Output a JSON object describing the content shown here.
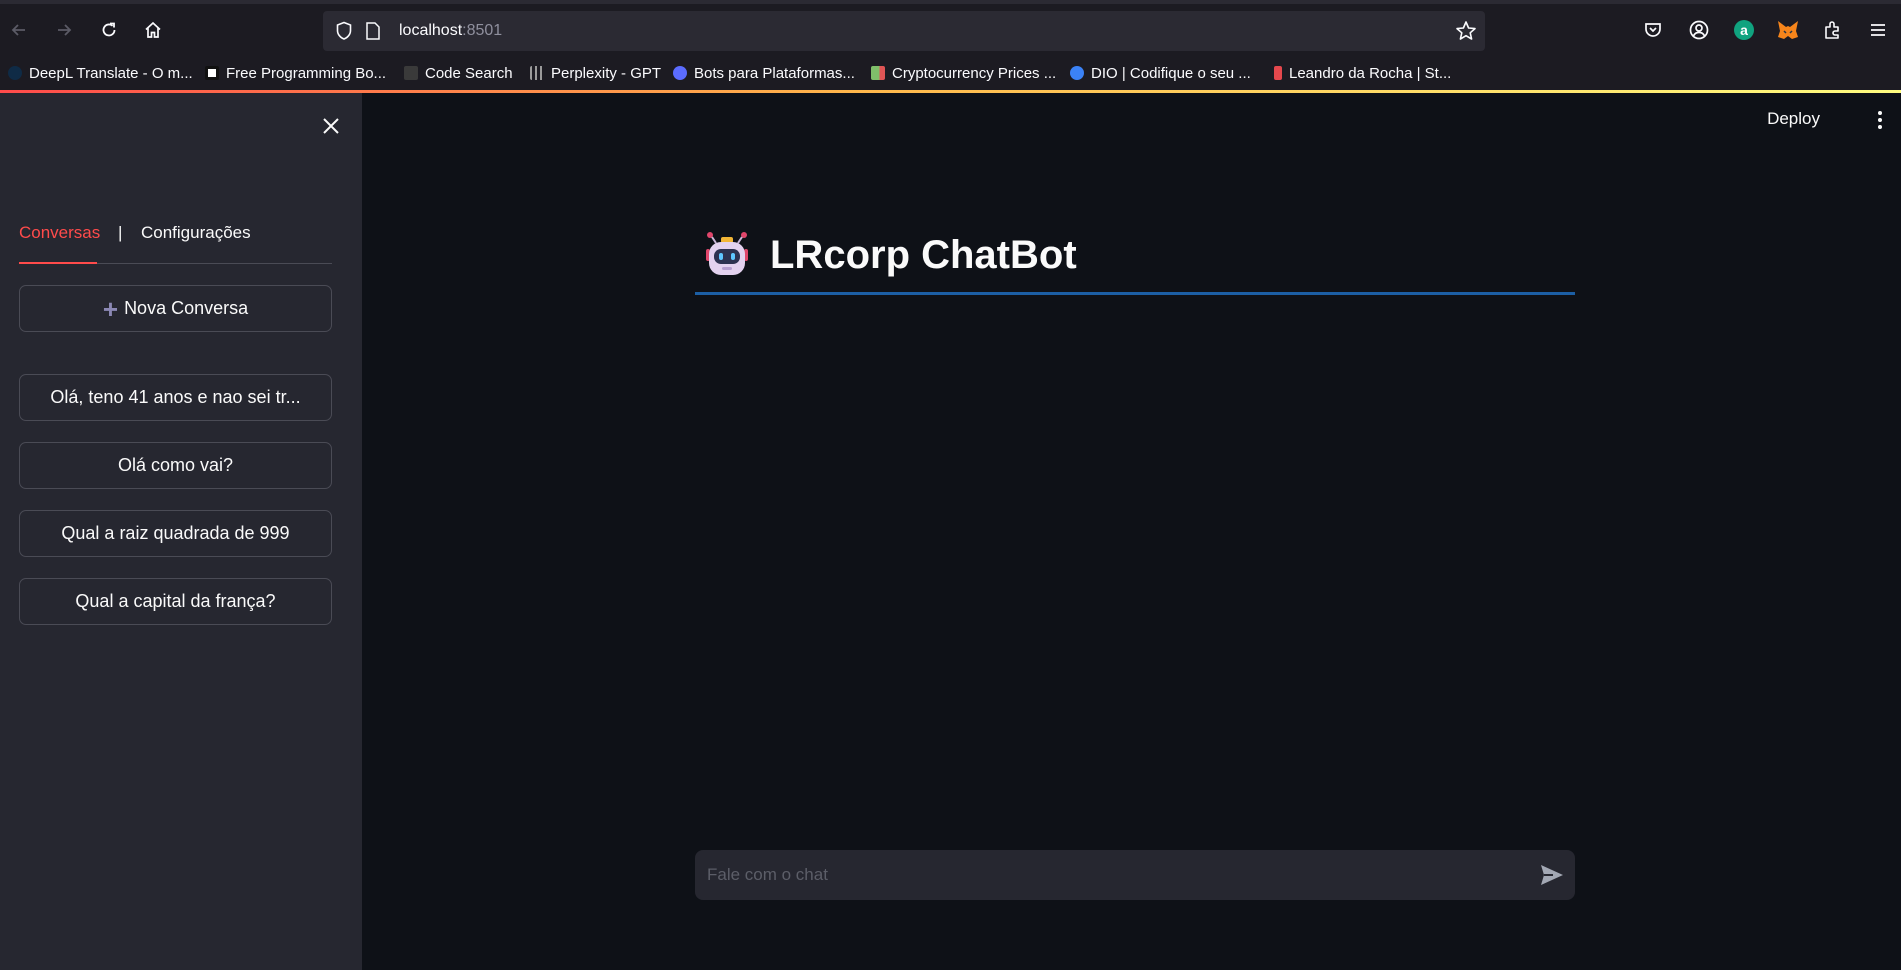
{
  "browser": {
    "url_host": "localhost",
    "url_port": ":8501",
    "bookmarks": [
      {
        "label": "DeepL Translate - O m...",
        "color": "#0f2b46"
      },
      {
        "label": "Free Programming Bo...",
        "color": "#ffffff"
      },
      {
        "label": "Code Search",
        "color": "#3a3a3a"
      },
      {
        "label": "Perplexity - GPT",
        "color": "#9a9a9a"
      },
      {
        "label": "Bots para Plataformas...",
        "color": "#5b6cff"
      },
      {
        "label": "Cryptocurrency Prices ...",
        "color": "#7fbf6a"
      },
      {
        "label": "DIO | Codifique o seu ...",
        "color": "#3b82f6"
      },
      {
        "label": "Leandro da Rocha | St...",
        "color": "#e5484d"
      }
    ],
    "icons": [
      "back-icon",
      "forward-icon",
      "reload-icon",
      "home-icon",
      "shield-icon",
      "page-icon",
      "star-icon",
      "pocket-icon",
      "account-icon",
      "extension-a-icon",
      "metamask-icon",
      "extensions-icon",
      "menu-icon"
    ]
  },
  "sidebar": {
    "tabs": [
      "Conversas",
      "Configurações"
    ],
    "tab_separator": "|",
    "new_chat_label": "Nova Conversa",
    "conversations": [
      "Olá, teno 41 anos e nao sei tr...",
      "Olá como vai?",
      "Qual a raiz quadrada de 999",
      "Qual a capital da frança?"
    ]
  },
  "main": {
    "deploy_label": "Deploy",
    "title": "LRcorp ChatBot",
    "chat_placeholder": "Fale com o chat"
  },
  "colors": {
    "accent": "#ff4b4b",
    "title_rule": "#1c5fa5",
    "sidebar_bg": "#262730",
    "main_bg": "#0e1117"
  }
}
